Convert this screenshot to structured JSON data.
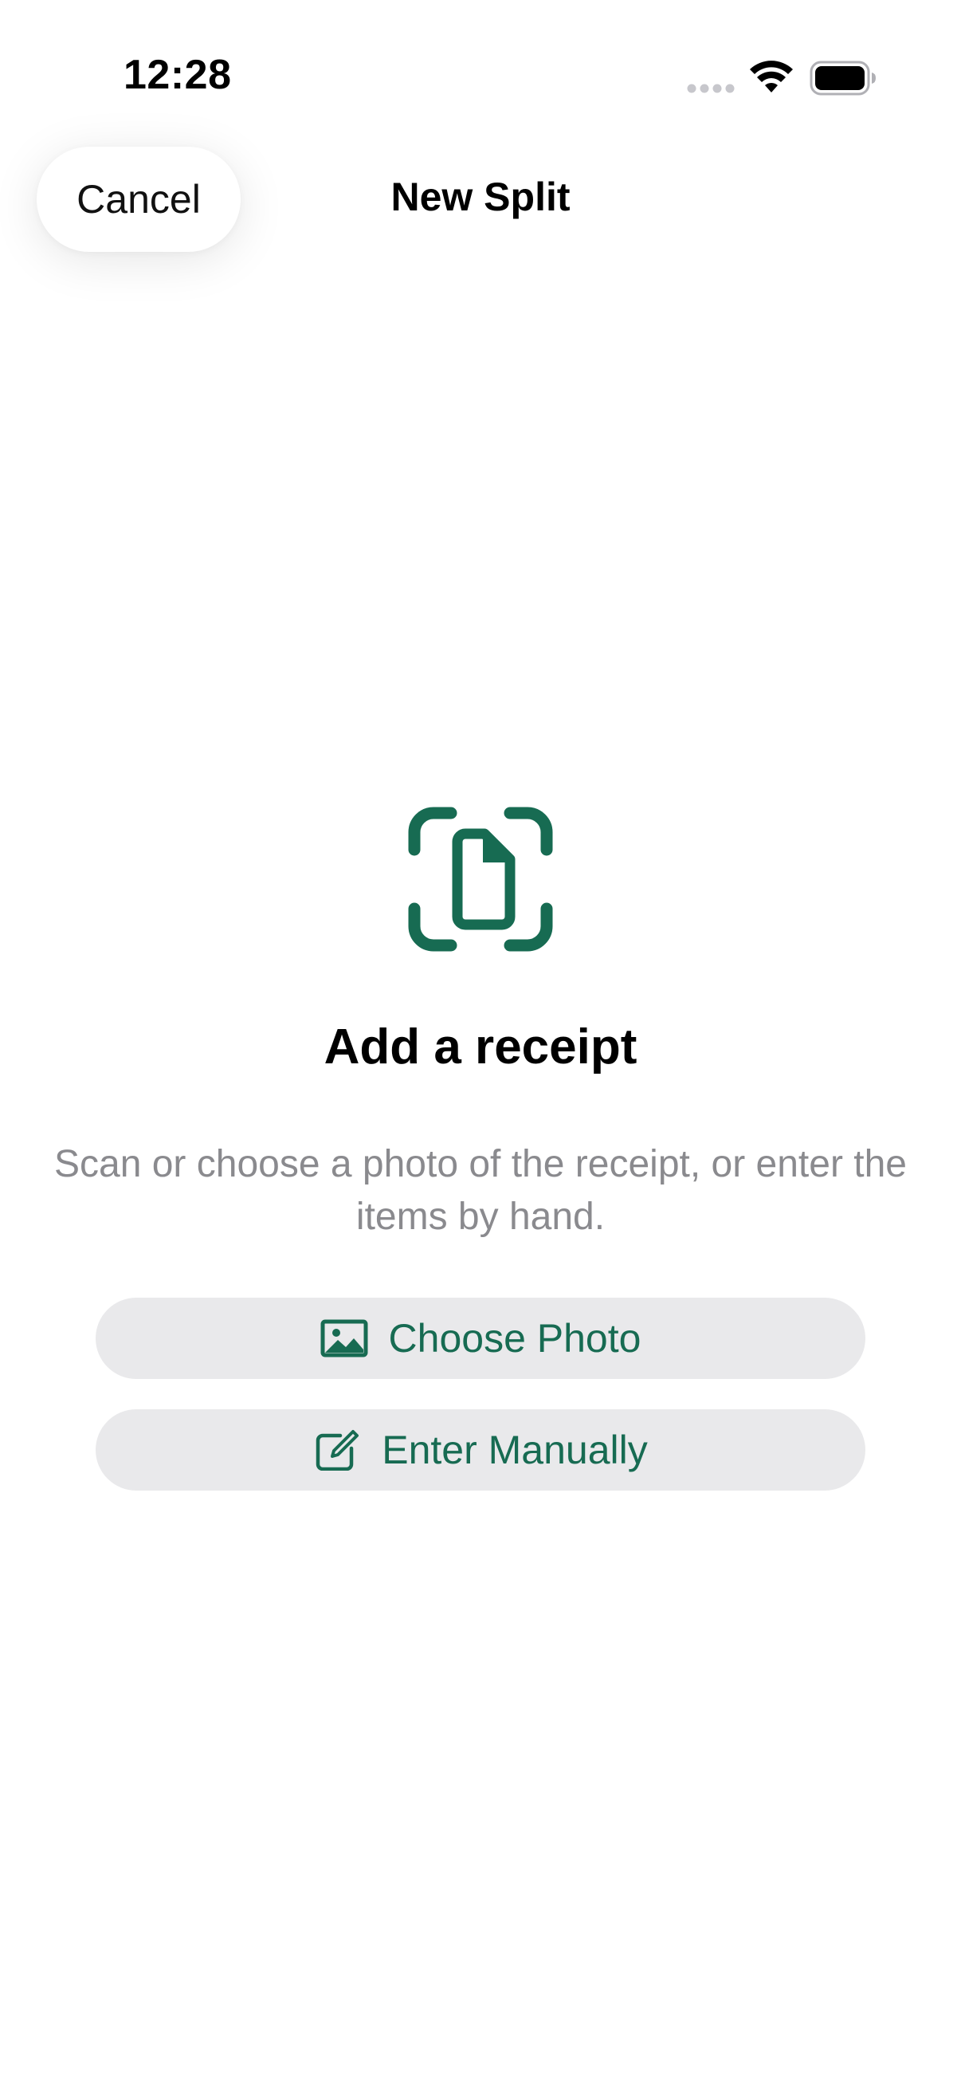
{
  "status_bar": {
    "time": "12:28",
    "icons": [
      "signal-dots-icon",
      "wifi-icon",
      "battery-icon"
    ]
  },
  "nav": {
    "cancel_label": "Cancel",
    "title": "New Split"
  },
  "main": {
    "icon": "receipt-scan-icon",
    "headline": "Add a receipt",
    "subtext": "Scan or choose a photo of the receipt, or enter the items by hand.",
    "buttons": [
      {
        "label": "Choose Photo",
        "icon": "photo-icon"
      },
      {
        "label": "Enter Manually",
        "icon": "compose-icon"
      }
    ]
  },
  "colors": {
    "accent": "#176b52",
    "button_bg": "#e9e9eb",
    "secondary_text": "#8a8a8e"
  }
}
